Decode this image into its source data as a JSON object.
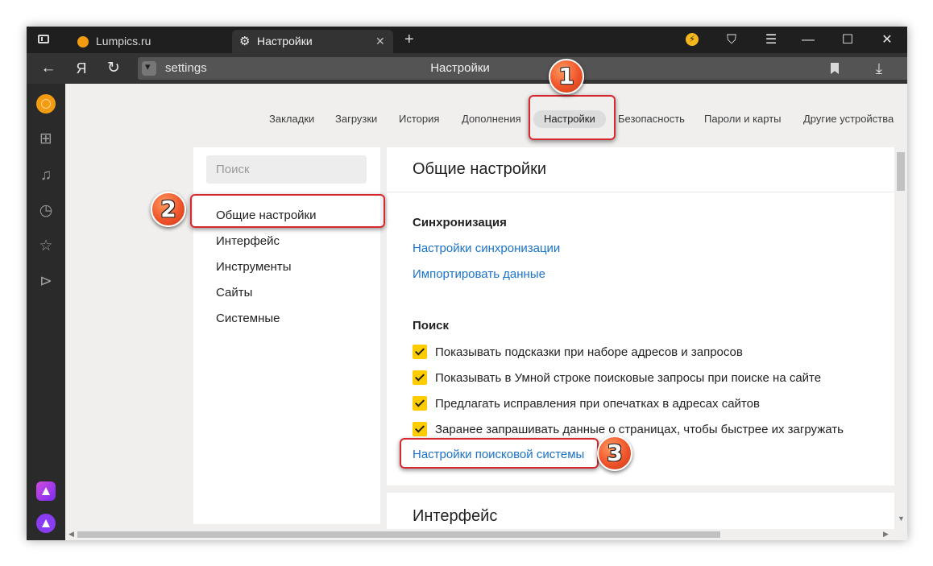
{
  "browser": {
    "tabs": [
      {
        "title": "Lumpics.ru"
      },
      {
        "title": "Настройки"
      }
    ],
    "tab_close": "✕",
    "new_tab": "+",
    "window_controls": {
      "menu": "☰",
      "minimize": "—",
      "maximize": "☐",
      "close": "✕"
    },
    "address": {
      "yandex_logo": "Я",
      "url": "settings",
      "title": "Настройки"
    }
  },
  "settings": {
    "topnav": [
      "Закладки",
      "Загрузки",
      "История",
      "Дополнения",
      "Настройки",
      "Безопасность",
      "Пароли и карты",
      "Другие устройства"
    ],
    "search_placeholder": "Поиск",
    "sidebar": [
      "Общие настройки",
      "Интерфейс",
      "Инструменты",
      "Сайты",
      "Системные"
    ],
    "panel_title": "Общие настройки",
    "sync": {
      "heading": "Синхронизация",
      "links": [
        "Настройки синхронизации",
        "Импортировать данные"
      ]
    },
    "search_section": {
      "heading": "Поиск",
      "checks": [
        {
          "label": "Показывать подсказки при наборе адресов и запросов",
          "checked": true
        },
        {
          "label": "Показывать в Умной строке поисковые запросы при поиске на сайте",
          "checked": true
        },
        {
          "label": "Предлагать исправления при опечатках в адресах сайтов",
          "checked": true
        },
        {
          "label": "Заранее запрашивать данные о страницах, чтобы быстрее их загружать",
          "checked": true
        }
      ],
      "engine_link": "Настройки поисковой системы"
    },
    "interface_title": "Интерфейс"
  },
  "annotations": [
    "1",
    "2",
    "3"
  ],
  "colors": {
    "accent_link": "#1a73c8",
    "checkbox": "#ffcc00",
    "highlight": "#d8282f",
    "badge": "#f0542a"
  }
}
